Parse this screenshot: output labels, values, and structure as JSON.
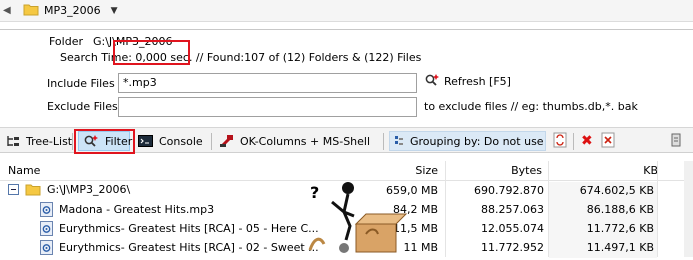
{
  "top_bar": {
    "title": "MP3_2006"
  },
  "info": {
    "folder_label": "Folder",
    "folder_path": "G:\\J\\MP3_2006",
    "stats": "Search Time: 0,000 sec. //  Found:107 of (12) Folders & (122) Files",
    "include_label": "Include Files",
    "include_value": "*.mp3",
    "exclude_label": "Exclude Files",
    "exclude_value": "",
    "refresh_label": "Refresh [F5]",
    "exclude_hint": "to exclude files // eg: thumbs.db,*. bak"
  },
  "toolbar": {
    "tree_list": "Tree-List",
    "filter": "Filter",
    "console": "Console",
    "ok_columns": "OK-Columns + MS-Shell",
    "grouping": "Grouping by: Do not use"
  },
  "columns": {
    "name": "Name",
    "size": "Size",
    "bytes": "Bytes",
    "kb": "KB"
  },
  "rows": [
    {
      "name": "G:\\J\\MP3_2006\\",
      "size": "659,0 MB",
      "bytes": "690.792.870",
      "kb": "674.602,5 KB"
    },
    {
      "name": "Madona - Greatest Hits.mp3",
      "size": "84,2 MB",
      "bytes": "88.257.063",
      "kb": "86.188,6 KB"
    },
    {
      "name": "Eurythmics- Greatest Hits [RCA] - 05 - Here C...",
      "size": "11,5 MB",
      "bytes": "12.055.074",
      "kb": "11.772,6 KB"
    },
    {
      "name": "Eurythmics- Greatest Hits [RCA] - 02 - Sweet ...",
      "size": "11 MB",
      "bytes": "11.772.952",
      "kb": "11.497,1 KB"
    }
  ],
  "colors": {
    "highlight": "#e0141e",
    "selected_bg": "#cce4f7",
    "folder": "#f5c842"
  },
  "icons": [
    "back-arrow-icon",
    "folder-icon",
    "chevron-down-icon",
    "find-refresh-icon",
    "tree-list-icon",
    "filter-icon",
    "console-icon",
    "ok-columns-icon",
    "grouping-icon",
    "refresh-icon",
    "delete-icon",
    "clear-icon",
    "extra-icon",
    "collapse-icon",
    "audio-file-icon"
  ]
}
